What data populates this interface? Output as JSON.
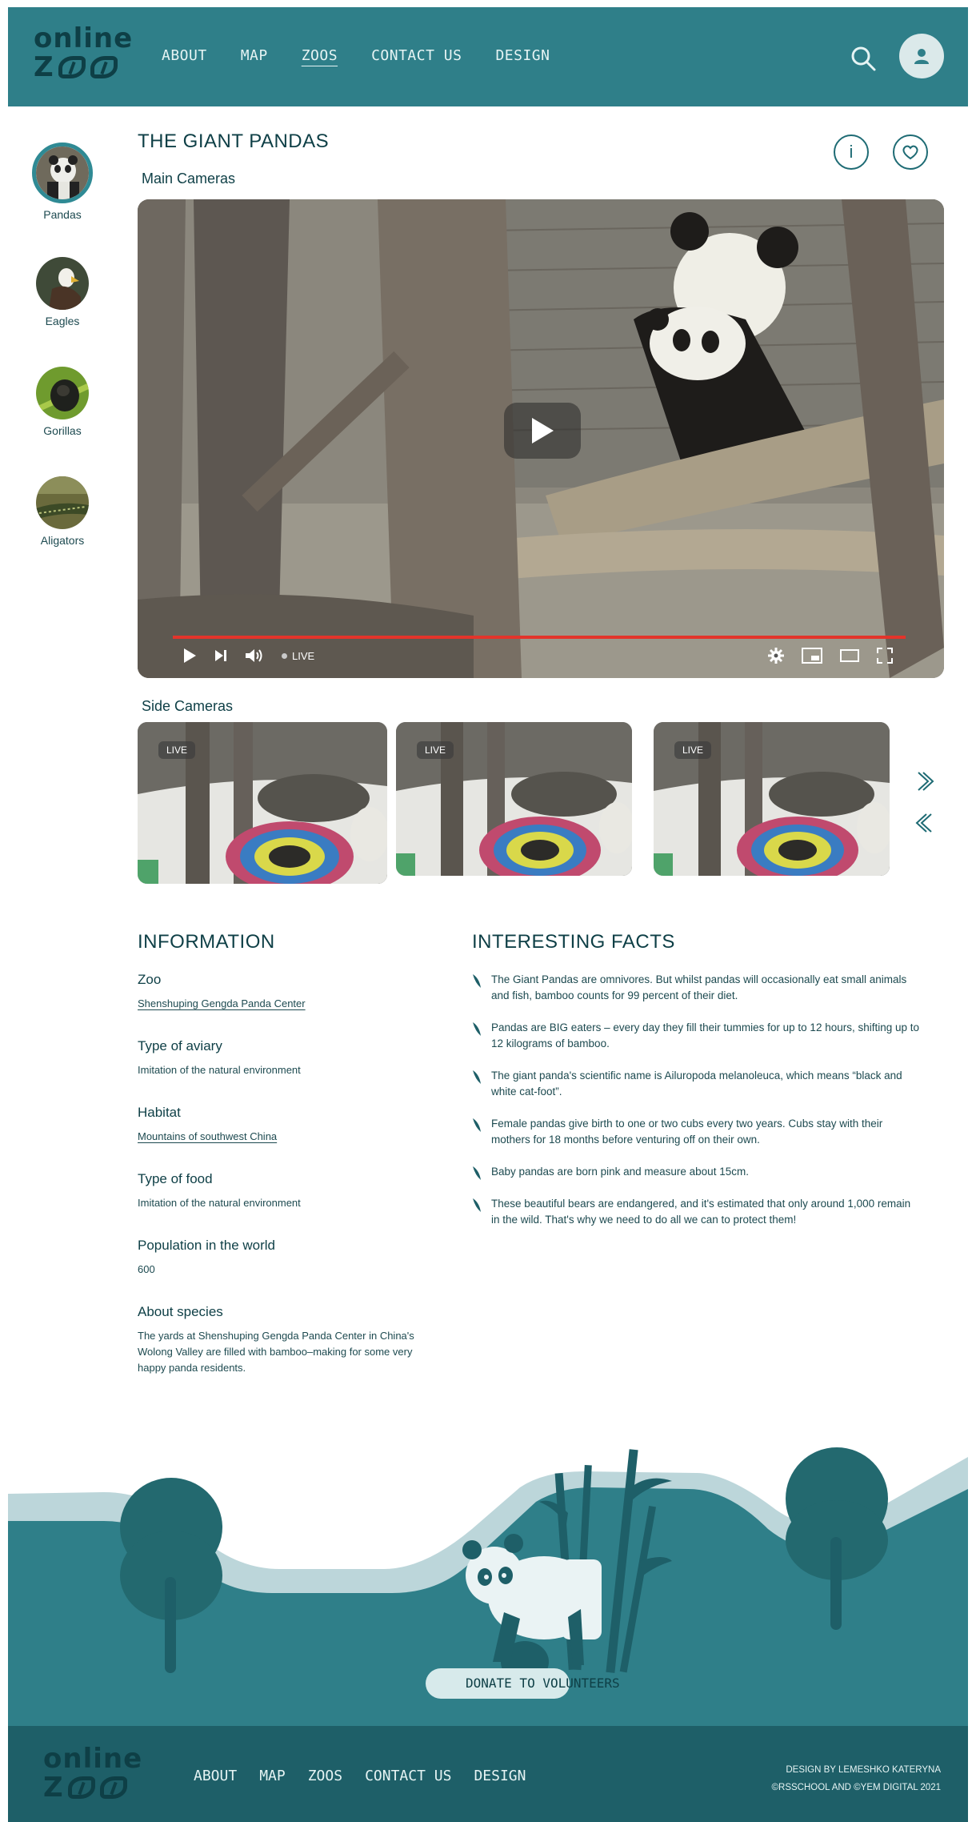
{
  "header": {
    "logo_top": "online",
    "logo_bottom": "Z",
    "nav": [
      "ABOUT",
      "MAP",
      "ZOOS",
      "CONTACT US",
      "DESIGN"
    ],
    "active_nav": "ZOOS"
  },
  "sidebar": {
    "animals": [
      {
        "label": "Pandas"
      },
      {
        "label": "Eagles"
      },
      {
        "label": "Gorillas"
      },
      {
        "label": "Aligators"
      }
    ]
  },
  "page": {
    "title": "THE GIANT PANDAS",
    "info_btn": "i",
    "main_cameras": "Main Cameras",
    "side_cameras": "Side Cameras"
  },
  "video": {
    "live": "LIVE",
    "progress_fraction": 0.92
  },
  "side_cams": [
    {
      "live": "LIVE"
    },
    {
      "live": "LIVE"
    },
    {
      "live": "LIVE"
    }
  ],
  "information": {
    "title": "INFORMATION",
    "items": [
      {
        "label": "Zoo",
        "value": "Shenshuping Gengda Panda Center"
      },
      {
        "label": "Type of aviary",
        "value": "Imitation of the natural environment"
      },
      {
        "label": "Habitat",
        "value": "Mountains of southwest China"
      },
      {
        "label": "Type of food",
        "value": "Imitation of the natural environment"
      },
      {
        "label": "Population in the world",
        "value": "600"
      },
      {
        "label": "About species",
        "value": "The yards at Shenshuping Gengda Panda Center in China's Wolong Valley are filled with bamboo–making for some very happy panda residents."
      }
    ]
  },
  "facts": {
    "title": "INTERESTING FACTS",
    "items": [
      "The Giant Pandas are omnivores. But whilst pandas will occasionally eat small animals and fish, bamboo counts for 99 percent of their diet.",
      "Pandas are BIG eaters – every day they fill their tummies for up to 12 hours, shifting up to 12 kilograms of bamboo.",
      "The giant panda's scientific name is Ailuropoda melanoleuca, which means “black and white cat-foot”.",
      "Female pandas give birth to one or two cubs every two years. Cubs stay with their mothers for 18 months before venturing off on their own.",
      "Baby pandas are born pink and measure about 15cm.",
      "These beautiful bears are endangered, and it's estimated that only around 1,000 remain in the wild. That's why we need to do all we can to protect them!"
    ]
  },
  "donate": {
    "label": "DONATE TO VOLUNTEERS"
  },
  "footer": {
    "logo_top": "online",
    "logo_bottom": "Z",
    "nav": [
      "ABOUT",
      "MAP",
      "ZOOS",
      "CONTACT US",
      "DESIGN"
    ],
    "credit1": "DESIGN BY LEMESHKO KATERYNA",
    "credit2": "©RSSCHOOL AND ©YEM DIGITAL 2021"
  }
}
